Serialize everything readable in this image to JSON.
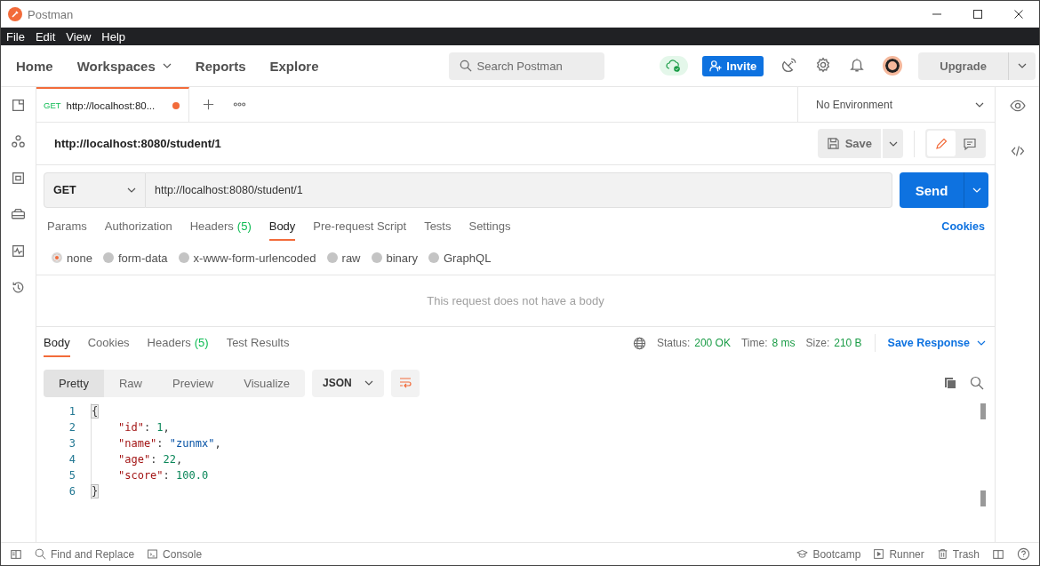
{
  "window": {
    "title": "Postman"
  },
  "menu": [
    "File",
    "Edit",
    "View",
    "Help"
  ],
  "nav": [
    {
      "label": "Home",
      "dropdown": false
    },
    {
      "label": "Workspaces",
      "dropdown": true
    },
    {
      "label": "Reports",
      "dropdown": false
    },
    {
      "label": "Explore",
      "dropdown": false
    }
  ],
  "search": {
    "placeholder": "Search Postman"
  },
  "invite": "Invite",
  "upgrade": "Upgrade",
  "tabs": [
    {
      "method": "GET",
      "label": "http://localhost:80...",
      "unsaved": true,
      "selected": true
    }
  ],
  "environment": "No Environment",
  "request": {
    "title": "http://localhost:8080/student/1",
    "save": "Save",
    "method": "GET",
    "url": "http://localhost:8080/student/1",
    "send": "Send",
    "cookies": "Cookies"
  },
  "request_tabs": [
    {
      "label": "Params",
      "selected": false
    },
    {
      "label": "Authorization",
      "selected": false
    },
    {
      "label": "Headers",
      "count": "(5)",
      "selected": false
    },
    {
      "label": "Body",
      "selected": true
    },
    {
      "label": "Pre-request Script",
      "selected": false
    },
    {
      "label": "Tests",
      "selected": false
    },
    {
      "label": "Settings",
      "selected": false
    }
  ],
  "body_types": [
    {
      "label": "none",
      "selected": true
    },
    {
      "label": "form-data",
      "selected": false
    },
    {
      "label": "x-www-form-urlencoded",
      "selected": false
    },
    {
      "label": "raw",
      "selected": false
    },
    {
      "label": "binary",
      "selected": false
    },
    {
      "label": "GraphQL",
      "selected": false
    }
  ],
  "empty_message": "This request does not have a body",
  "response_tabs": [
    {
      "label": "Body",
      "selected": true
    },
    {
      "label": "Cookies",
      "selected": false
    },
    {
      "label": "Headers",
      "count": "(5)",
      "selected": false
    },
    {
      "label": "Test Results",
      "selected": false
    }
  ],
  "response_meta": [
    {
      "label": "Status:",
      "value": "200 OK"
    },
    {
      "label": "Time:",
      "value": "8 ms"
    },
    {
      "label": "Size:",
      "value": "210 B"
    }
  ],
  "save_response": "Save Response",
  "view_modes": [
    {
      "label": "Pretty",
      "selected": true
    },
    {
      "label": "Raw",
      "selected": false
    },
    {
      "label": "Preview",
      "selected": false
    },
    {
      "label": "Visualize",
      "selected": false
    }
  ],
  "format": "JSON",
  "code": [
    {
      "number": "1",
      "tokens": [
        {
          "kind": "bracket",
          "text": "{"
        }
      ]
    },
    {
      "number": "2",
      "tokens": [
        {
          "kind": "key",
          "text": "\"id\""
        },
        {
          "kind": "punct",
          "text": ": "
        },
        {
          "kind": "number",
          "text": "1"
        },
        {
          "kind": "punct",
          "text": ","
        }
      ]
    },
    {
      "number": "3",
      "tokens": [
        {
          "kind": "key",
          "text": "\"name\""
        },
        {
          "kind": "punct",
          "text": ": "
        },
        {
          "kind": "string",
          "text": "\"zunmx\""
        },
        {
          "kind": "punct",
          "text": ","
        }
      ]
    },
    {
      "number": "4",
      "tokens": [
        {
          "kind": "key",
          "text": "\"age\""
        },
        {
          "kind": "punct",
          "text": ": "
        },
        {
          "kind": "number",
          "text": "22"
        },
        {
          "kind": "punct",
          "text": ","
        }
      ]
    },
    {
      "number": "5",
      "tokens": [
        {
          "kind": "key",
          "text": "\"score\""
        },
        {
          "kind": "punct",
          "text": ": "
        },
        {
          "kind": "number",
          "text": "100.0"
        }
      ]
    },
    {
      "number": "6",
      "tokens": [
        {
          "kind": "bracket",
          "text": "}"
        }
      ]
    }
  ],
  "status_bar": {
    "left": [
      "Find and Replace",
      "Console"
    ],
    "right": [
      "Bootcamp",
      "Runner",
      "Trash"
    ]
  }
}
